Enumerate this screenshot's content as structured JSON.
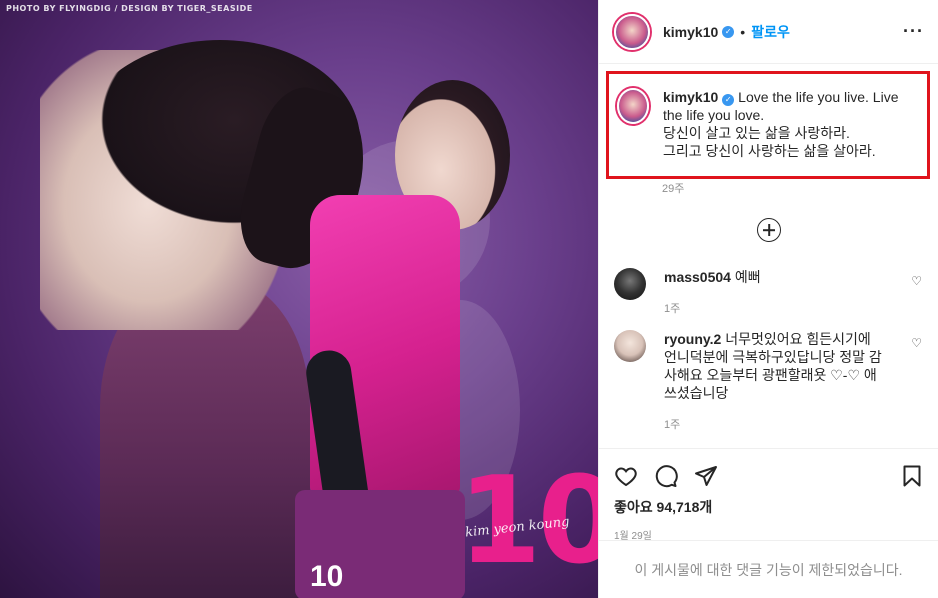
{
  "media": {
    "credit": "PHOTO BY FLYINGDIG / DESIGN BY TIGER_SEASIDE",
    "jersey_number": "10",
    "big_number": "10",
    "signature": "kim yeon koung"
  },
  "header": {
    "username": "kimyk10",
    "separator": "•",
    "follow_label": "팔로우",
    "more_label": "···"
  },
  "caption": {
    "username": "kimyk10",
    "line1": "Love the life you live. Live the life you love.",
    "line2": "당신이 살고 있는 삶을 사랑하라.",
    "line3": "그리고 당신이 사랑하는 삶을 살아라.",
    "time": "29주",
    "highlight_color": "#e0141c"
  },
  "comments": [
    {
      "username": "mass0504",
      "text": "예뻐",
      "time": "1주"
    },
    {
      "username": "ryouny.2",
      "text": "너무멋있어요 힘든시기에 언니덕분에 극복하구있답니당 정말 감사해요 오늘부터 광팬할래욧 ♡-♡ 애쓰셨습니당",
      "time": "1주"
    }
  ],
  "actions": {
    "likes": "좋아요 94,718개",
    "date": "1월 29일",
    "disabled_notice": "이 게시물에 대한 댓글 기능이 제한되었습니다."
  },
  "colors": {
    "follow": "#0095f6",
    "verified": "#3897f0",
    "accent_pink": "#e8208c"
  }
}
